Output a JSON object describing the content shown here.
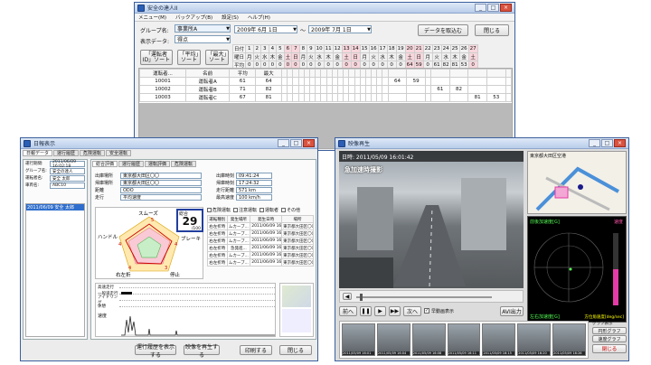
{
  "main_window": {
    "title": "安全の達人II",
    "menu": [
      "メニュー(M)",
      "バックアップ(B)",
      "設定(S)",
      "ヘルプ(H)"
    ],
    "group_label": "グループ名:",
    "group_value": "事業所A",
    "display_label": "表示データ:",
    "display_value": "得点",
    "date_from": "2009年 6月 1日",
    "date_to": "2009年 7月 1日",
    "tilde": "～",
    "load_button": "データを取込む",
    "close_button": "閉じる",
    "sort_buttons": [
      "「運転者ID」ソート",
      "「平均」ソート",
      "「最大」ソート"
    ],
    "row_labels": [
      "日付",
      "曜日",
      "平均",
      "最大"
    ],
    "days": [
      "1",
      "2",
      "3",
      "4",
      "5",
      "6",
      "7",
      "8",
      "9",
      "10",
      "11",
      "12",
      "13",
      "14",
      "15",
      "16",
      "17",
      "18",
      "19",
      "20",
      "21",
      "22",
      "23",
      "24",
      "25",
      "26",
      "27",
      "28",
      "29",
      "30",
      "1"
    ],
    "weekdays": [
      "月",
      "火",
      "水",
      "木",
      "金",
      "土",
      "日",
      "月",
      "火",
      "水",
      "木",
      "金",
      "土",
      "日",
      "月",
      "火",
      "水",
      "木",
      "金",
      "土",
      "日",
      "月",
      "火",
      "水",
      "木",
      "金",
      "土",
      "日",
      "月",
      "火",
      "水"
    ],
    "averages_row": [
      "0",
      "0",
      "0",
      "0",
      "0",
      "0",
      "0",
      "0",
      "0",
      "0",
      "0",
      "0",
      "0",
      "0",
      "0",
      "0",
      "0",
      "0",
      "0",
      "64",
      "59",
      "0",
      "61",
      "82",
      "81",
      "53",
      "0"
    ],
    "max_row": [
      "0",
      "0",
      "0",
      "0",
      "0",
      "0",
      "0",
      "0",
      "0",
      "0",
      "0",
      "0",
      "0",
      "0",
      "0",
      "0",
      "0",
      "0",
      "0",
      "64",
      "59",
      "0",
      "61",
      "82",
      "81",
      "53",
      "0"
    ],
    "col_headers": [
      "運転者...",
      "名前",
      "平均"
    ],
    "drivers": [
      {
        "id": "10001",
        "name": "運転者A",
        "avg": "61",
        "max": "64",
        "scores": [
          "64",
          "59"
        ]
      },
      {
        "id": "10002",
        "name": "運転者B",
        "avg": "71",
        "max": "82",
        "scores": [
          "61",
          "82"
        ]
      },
      {
        "id": "10003",
        "name": "運転者C",
        "avg": "67",
        "max": "81",
        "scores": [
          "81",
          "53"
        ]
      }
    ]
  },
  "detail_window": {
    "title": "日報表示",
    "tabs": [
      "日報データ",
      "運行履歴",
      "危険運転",
      "安全運転"
    ],
    "left_fields": [
      {
        "label": "運行期間:",
        "value": "2011/06/09 16:02:18"
      },
      {
        "label": "グループ名:",
        "value": "安全の達人"
      },
      {
        "label": "運転者名:",
        "value": "安全 太郎"
      },
      {
        "label": "車両名:",
        "value": "ABC10"
      }
    ],
    "list_item": "2011/06/09 安全 太郎",
    "inner_tabs": [
      "総合評価",
      "運行履歴",
      "運転評価",
      "危険運転"
    ],
    "info_rows": [
      {
        "label": "出庫場所",
        "value": "東京都大田区〇〇",
        "label2": "出庫時刻",
        "value2": "09:41:24"
      },
      {
        "label": "帰庫場所",
        "value": "東京都大田区〇〇",
        "label2": "帰庫時刻",
        "value2": "17:24:32"
      },
      {
        "label": "距離",
        "value": "ODO",
        "label2": "走行距離",
        "value2": "571 km"
      },
      {
        "label": "走行",
        "value": "平均速度",
        "label2": "最高速度",
        "value2": "100 km/h"
      }
    ],
    "radar_labels": [
      "スムーズ",
      "ブレーキ",
      "停止",
      "右左折",
      "ハンドル"
    ],
    "radar_values": [
      "5",
      "4",
      "3",
      "4",
      "4"
    ],
    "score_label": "総合",
    "score_value": "29",
    "score_unit": "/100",
    "event_tabs": [
      "危険運転",
      "注意運転",
      "運転者",
      "その他"
    ],
    "event_header": [
      "運転種別",
      "発生場所",
      "発生日時",
      "場所"
    ],
    "event_rows": [
      [
        "右左折時",
        "ムカーブ...",
        "2011/06/09 16:07:14",
        "東京都大田区〇〇"
      ],
      [
        "右左折時",
        "ムカーブ...",
        "2011/06/09 16:07:33",
        "東京都大田区〇〇"
      ],
      [
        "右左折時",
        "ムカーブ...",
        "2011/06/09 16:12:04",
        "東京都大田区〇〇"
      ],
      [
        "右左折時",
        "急発進...",
        "2011/06/09 16:15:20",
        "東京都大田区〇〇"
      ],
      [
        "右左折時",
        "ムカーブ...",
        "2011/06/09 16:19:41",
        "東京都大田区〇〇"
      ],
      [
        "右左折時",
        "ムカーブ...",
        "2011/06/09 16:22:58",
        "東京都大田区〇〇"
      ]
    ],
    "timeline_labels": [
      "高速走行",
      "一般道走行",
      "アイドリング",
      "休憩"
    ],
    "chart_label": "速度",
    "bottom_buttons": [
      "運行履歴を表示する",
      "映像を再生する",
      "印刷する",
      "閉じる"
    ]
  },
  "video_window": {
    "title": "映像再生",
    "timestamp": "日時: 2011/05/09 16:01:42",
    "overlay_text": "急加速時撮影",
    "map_label": "東京都大田区空港",
    "speed_label": "速度",
    "gsensor_label": "前後加速度[G]",
    "gauge_label": "左右加速度[G]",
    "angle_label": "方位角速度[deg/sec]",
    "controls": [
      "前へ",
      "次へ",
      "AVI出力"
    ],
    "checkbox_label": "早動画表示",
    "side_buttons": [
      "円形グラフ",
      "速度グラフ",
      "閉じる"
    ],
    "side_title": "グラフ表示",
    "thumb_times": [
      "2011/05/09 16:01",
      "2011/05/09 16:04",
      "2011/05/09 16:08",
      "2011/05/09 16:11",
      "2011/05/09 16:15",
      "2011/05/09 16:20",
      "2011/05/09 16:26"
    ],
    "accent": "#e63aa6"
  }
}
